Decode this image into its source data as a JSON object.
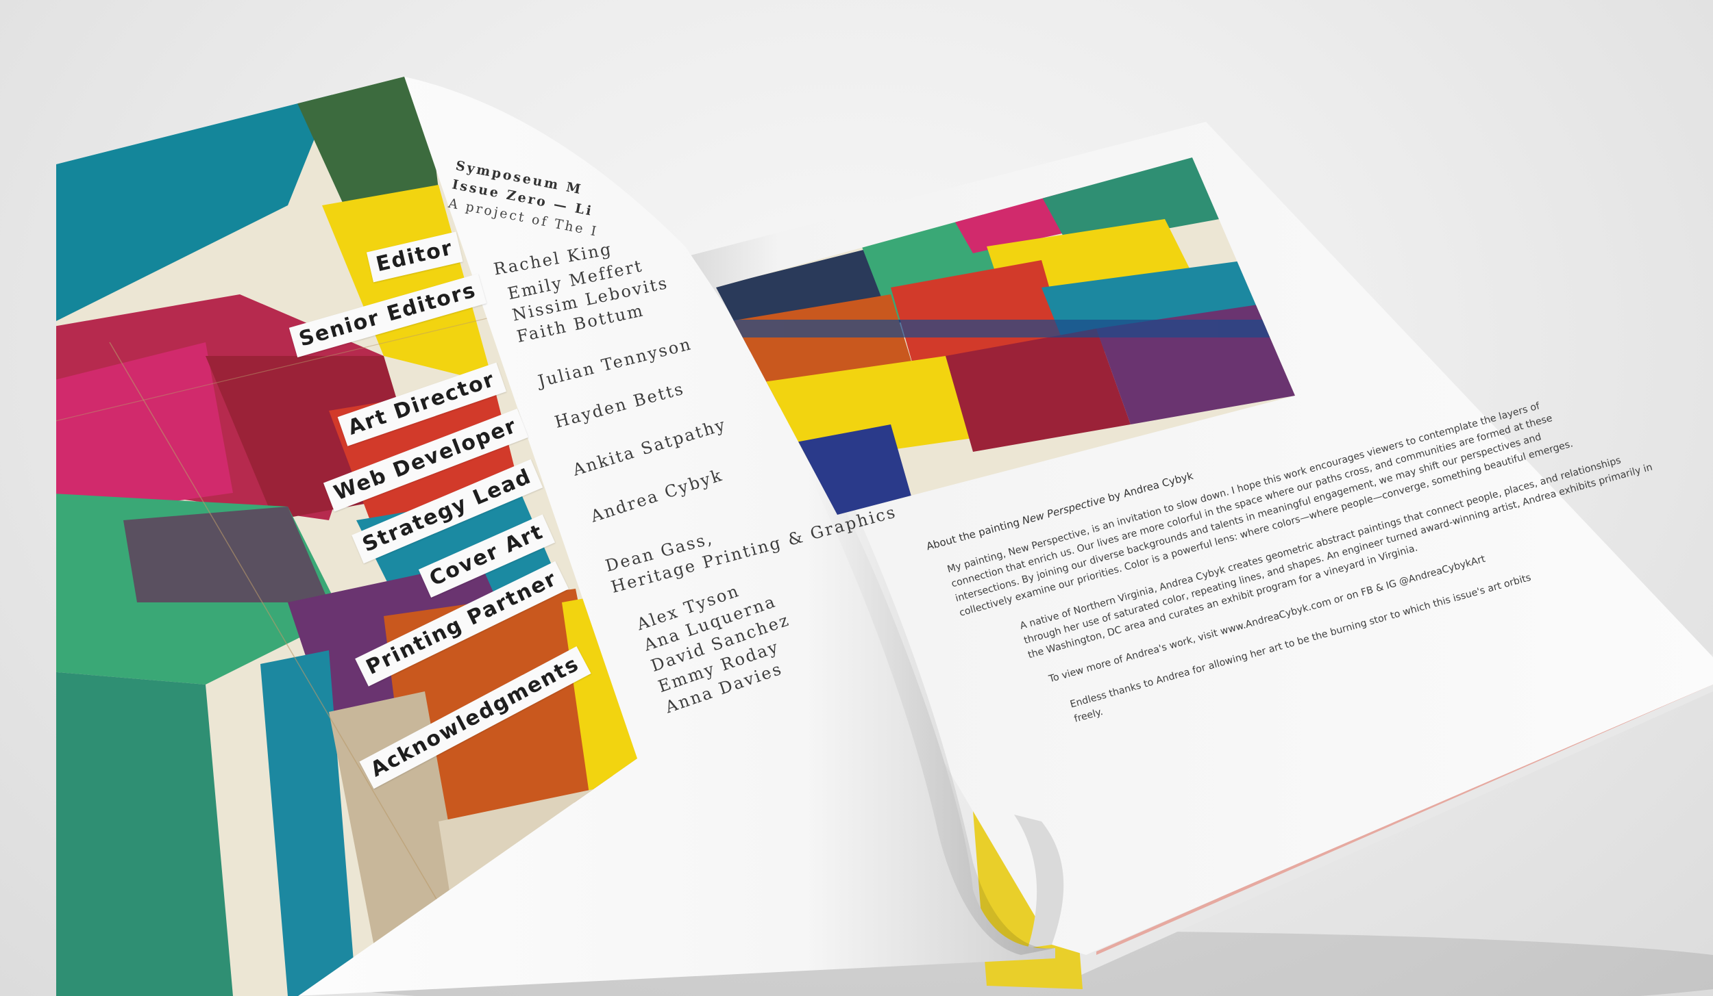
{
  "masthead": {
    "line1": "Symposeum M",
    "line2": "Issue Zero — Li",
    "line3": "A project of The I"
  },
  "credits": [
    {
      "role": "Editor",
      "names": [
        "Rachel King"
      ]
    },
    {
      "role": "Senior Editors",
      "names": [
        "Emily Meffert",
        "Nissim Lebovits",
        "Faith Bottum"
      ]
    },
    {
      "role": "Art Director",
      "names": [
        "Julian Tennyson"
      ]
    },
    {
      "role": "Web Developer",
      "names": [
        "Hayden Betts"
      ]
    },
    {
      "role": "Strategy Lead",
      "names": [
        "Ankita Satpathy"
      ]
    },
    {
      "role": "Cover Art",
      "names": [
        "Andrea Cybyk"
      ]
    },
    {
      "role": "Printing Partner",
      "names": [
        "Dean Gass,",
        "Heritage Printing & Graphics"
      ]
    },
    {
      "role": "Acknowledgments",
      "names": [
        "Alex Tyson",
        "Ana Luquerna",
        "David Sanchez",
        "Emmy Roday",
        "Anna Davies"
      ]
    }
  ],
  "right_page": {
    "caption_prefix": "About the painting ",
    "caption_title": "New Perspective",
    "caption_suffix": " by Andrea Cybyk",
    "para1": "My painting, New Perspective, is an invitation to slow down. I hope this work encourages viewers to contemplate the layers of connection that enrich us. Our lives are more colorful in the space where our paths cross, and communities are formed at these intersections. By joining our diverse backgrounds and talents in meaningful engagement, we may shift our perspectives and collectively examine our priorities. Color is a powerful lens: where colors—where people—converge, something beautiful emerges.",
    "para2": "A native of Northern Virginia, Andrea Cybyk creates geometric abstract paintings that connect people, places, and relationships through her use of saturated color, repeating lines, and shapes. An engineer turned award-winning artist, Andrea exhibits primarily in the Washington, DC area and curates an exhibit program for a vineyard in Virginia.",
    "para3": "To view more of Andrea's work, visit www.AndreaCybyk.com or on FB & IG @AndreaCybykArt",
    "para4": "Endless thanks to Andrea for allowing her art to be the burning stor to which this issue's art orbits freely."
  },
  "colors": {
    "teal": "#14869a",
    "magenta": "#d12a6c",
    "yellow": "#f2d410",
    "orange": "#c9581e",
    "green": "#3aa876",
    "cream": "#ece6d4",
    "purple": "#6a3470"
  }
}
